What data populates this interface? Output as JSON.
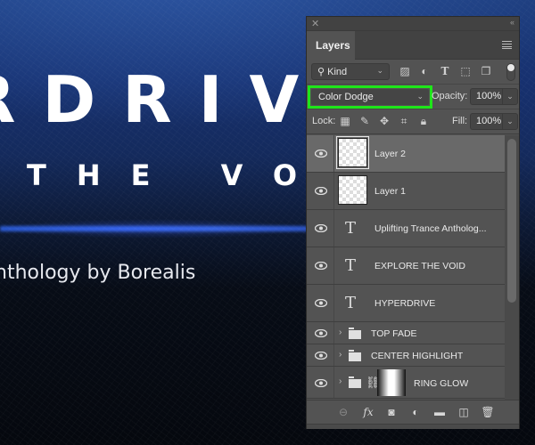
{
  "canvas": {
    "headline": "RDRIV",
    "subheadline": "THE VOI",
    "credit": "nthology by Borealis"
  },
  "panel": {
    "close_icon": "close-icon",
    "collapse_label": "‹‹",
    "tab_label": "Layers",
    "filter": {
      "kind_label": "Kind",
      "kind_icon": "search-icon",
      "icons": [
        "image-filter-icon",
        "adjustment-filter-icon",
        "type-filter-icon",
        "shape-filter-icon",
        "smart-object-filter-icon"
      ]
    },
    "blend_mode": "Color Dodge",
    "opacity_label": "Opacity:",
    "opacity_value": "100%",
    "lock_label": "Lock:",
    "lock_icons": [
      "lock-transparent-icon",
      "lock-image-icon",
      "lock-position-icon",
      "lock-artboard-icon",
      "lock-all-icon"
    ],
    "fill_label": "Fill:",
    "fill_value": "100%",
    "highlight_color": "#1ee619",
    "layers": [
      {
        "name": "Layer 2",
        "type": "pixel",
        "visible": true,
        "selected": true
      },
      {
        "name": "Layer 1",
        "type": "pixel",
        "visible": true,
        "selected": false
      },
      {
        "name": "Uplifting Trance Antholog...",
        "type": "text",
        "visible": true,
        "selected": false
      },
      {
        "name": "EXPLORE THE VOID",
        "type": "text",
        "visible": true,
        "selected": false
      },
      {
        "name": "HYPERDRIVE",
        "type": "text",
        "visible": true,
        "selected": false
      },
      {
        "name": "TOP FADE",
        "type": "group",
        "visible": true,
        "selected": false
      },
      {
        "name": "CENTER HIGHLIGHT",
        "type": "group",
        "visible": true,
        "selected": false
      },
      {
        "name": "RING GLOW",
        "type": "group-masked",
        "visible": true,
        "selected": false
      }
    ],
    "footer_icons": [
      "link-layers-icon",
      "fx-icon",
      "add-mask-icon",
      "adjustment-layer-icon",
      "new-group-icon",
      "new-layer-icon",
      "delete-icon"
    ]
  }
}
